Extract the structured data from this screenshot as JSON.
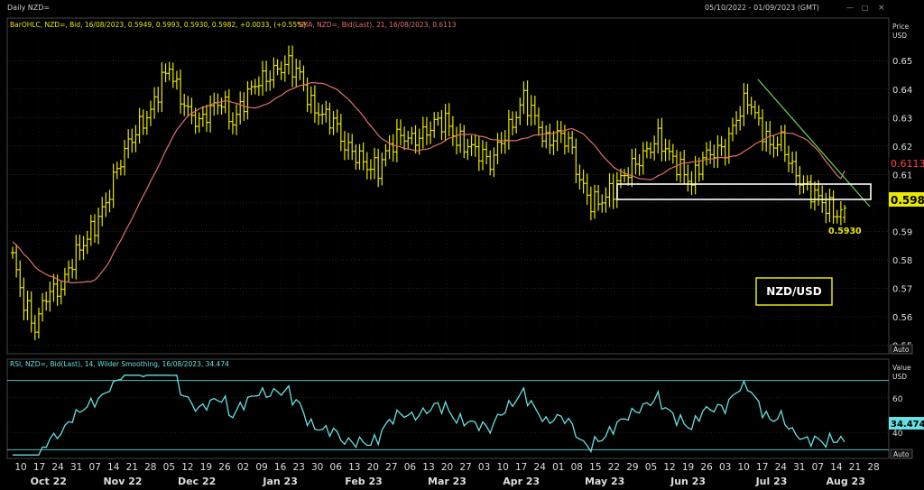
{
  "header": {
    "title": "Daily NZD=",
    "range": "05/10/2022 - 01/09/2023 (GMT)",
    "win_buttons": [
      "—",
      "□",
      "×"
    ]
  },
  "legend_price": {
    "bar_label": "BarOHLC, NZD=, Bid, 16/08/2023, 0.5949, 0.5993, 0.5930, 0.5982, +0.0033, (+0.55%)",
    "sma_label": "SMA, NZD=, Bid(Last), 21, 16/08/2023, 0.6113"
  },
  "legend_rsi": {
    "label": "RSI, NZD=, Bid(Last), 14, Wilder Smoothing, 16/08/2023, 34.474"
  },
  "axis_headers": {
    "price": "Price",
    "price_unit": "USD",
    "rsi": "Value",
    "rsi_unit": "USD",
    "auto_price": "Auto",
    "auto_rsi": "Auto"
  },
  "annotations": {
    "pair_box": "NZD/USD",
    "low_label": "0.5930",
    "last_price_tag": "0.598",
    "sma_tag": "0.6113",
    "rsi_tag": "34.474"
  },
  "colors": {
    "bars": "#e8e800",
    "sma": "#e07070",
    "trendline": "#66cc44",
    "rsi": "#66e0e0",
    "rsi_bands": "#55bbbb",
    "background": "#000000",
    "grid": "#3a3a3a"
  },
  "chart_data": [
    {
      "type": "ohlc",
      "y_axis_ticks": [
        "0.65",
        "0.64",
        "0.63",
        "0.62",
        "0.61",
        "0.60",
        "0.59",
        "0.58",
        "0.57",
        "0.56",
        "0.55"
      ],
      "ylim": [
        0.547,
        0.658
      ],
      "x_day_ticks": [
        "10",
        "17",
        "24",
        "31",
        "07",
        "14",
        "21",
        "28",
        "05",
        "12",
        "19",
        "26",
        "02",
        "09",
        "16",
        "23",
        "30",
        "06",
        "13",
        "20",
        "27",
        "06",
        "13",
        "20",
        "27",
        "03",
        "10",
        "17",
        "24",
        "01",
        "08",
        "15",
        "22",
        "29",
        "05",
        "12",
        "19",
        "26",
        "03",
        "10",
        "17",
        "24",
        "31",
        "07",
        "14",
        "21",
        "28"
      ],
      "x_month_labels": [
        "Oct 22",
        "Nov 22",
        "Dec 22",
        "Jan 23",
        "Feb 23",
        "Mar 23",
        "Apr 23",
        "May 23",
        "Jun 23",
        "Jul 23",
        "Aug 23"
      ],
      "close_anchors": [
        [
          0,
          0.581
        ],
        [
          3,
          0.565
        ],
        [
          6,
          0.556
        ],
        [
          9,
          0.568
        ],
        [
          13,
          0.57
        ],
        [
          16,
          0.58
        ],
        [
          19,
          0.586
        ],
        [
          22,
          0.592
        ],
        [
          25,
          0.6
        ],
        [
          28,
          0.612
        ],
        [
          31,
          0.621
        ],
        [
          34,
          0.627
        ],
        [
          37,
          0.632
        ],
        [
          40,
          0.643
        ],
        [
          42,
          0.648
        ],
        [
          44,
          0.64
        ],
        [
          47,
          0.632
        ],
        [
          50,
          0.628
        ],
        [
          53,
          0.633
        ],
        [
          56,
          0.636
        ],
        [
          59,
          0.628
        ],
        [
          62,
          0.636
        ],
        [
          65,
          0.642
        ],
        [
          68,
          0.644
        ],
        [
          71,
          0.647
        ],
        [
          74,
          0.649
        ],
        [
          77,
          0.645
        ],
        [
          80,
          0.634
        ],
        [
          83,
          0.631
        ],
        [
          86,
          0.629
        ],
        [
          89,
          0.62
        ],
        [
          92,
          0.617
        ],
        [
          95,
          0.613
        ],
        [
          98,
          0.612
        ],
        [
          101,
          0.62
        ],
        [
          104,
          0.624
        ],
        [
          107,
          0.622
        ],
        [
          110,
          0.624
        ],
        [
          113,
          0.628
        ],
        [
          116,
          0.629
        ],
        [
          119,
          0.622
        ],
        [
          122,
          0.62
        ],
        [
          125,
          0.618
        ],
        [
          128,
          0.614
        ],
        [
          131,
          0.622
        ],
        [
          134,
          0.628
        ],
        [
          137,
          0.637
        ],
        [
          140,
          0.63
        ],
        [
          143,
          0.621
        ],
        [
          146,
          0.624
        ],
        [
          149,
          0.622
        ],
        [
          152,
          0.608
        ],
        [
          155,
          0.6
        ],
        [
          158,
          0.601
        ],
        [
          161,
          0.605
        ],
        [
          164,
          0.61
        ],
        [
          167,
          0.614
        ],
        [
          170,
          0.618
        ],
        [
          173,
          0.623
        ],
        [
          176,
          0.617
        ],
        [
          179,
          0.612
        ],
        [
          182,
          0.607
        ],
        [
          185,
          0.616
        ],
        [
          188,
          0.618
        ],
        [
          191,
          0.619
        ],
        [
          194,
          0.63
        ],
        [
          197,
          0.637
        ],
        [
          200,
          0.628
        ],
        [
          203,
          0.62
        ],
        [
          206,
          0.622
        ],
        [
          209,
          0.612
        ],
        [
          212,
          0.606
        ],
        [
          215,
          0.603
        ],
        [
          218,
          0.599
        ],
        [
          221,
          0.596
        ],
        [
          223,
          0.598
        ]
      ],
      "last_bar": {
        "date": "16/08/2023",
        "open": 0.5949,
        "high": 0.5993,
        "low": 0.593,
        "close": 0.5982
      }
    },
    {
      "type": "line",
      "name": "SMA, NZD=, Bid(Last), 21",
      "period": 21,
      "last_value": 0.6113
    },
    {
      "type": "line",
      "name": "RSI, NZD=, Bid(Last), 14, Wilder Smoothing",
      "y_axis_ticks": [
        "60",
        "40"
      ],
      "ylim": [
        25,
        75
      ],
      "bands": [
        70,
        30
      ],
      "last_value": 34.474
    }
  ]
}
